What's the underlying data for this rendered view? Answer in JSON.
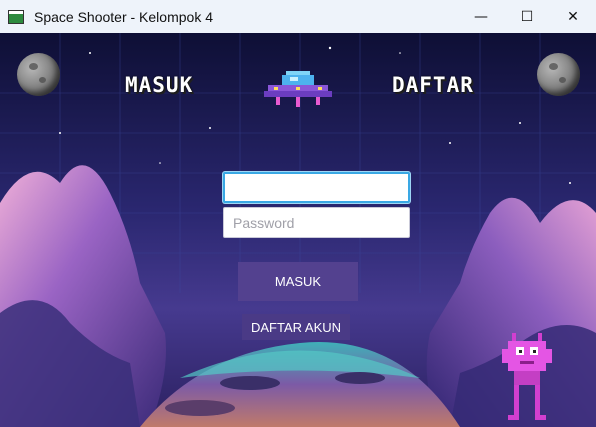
{
  "window": {
    "title": "Space Shooter - Kelompok 4",
    "minimize_glyph": "—",
    "maximize_glyph": "☐",
    "close_glyph": "✕"
  },
  "nav": {
    "login_label": "MASUK",
    "register_label": "DAFTAR"
  },
  "form": {
    "username_value": "",
    "username_placeholder": "",
    "password_placeholder": "Password"
  },
  "buttons": {
    "login_label": "MASUK",
    "register_account_label": "DAFTAR AKUN"
  },
  "icons": [
    "app-icon",
    "moon-icon",
    "ufo-icon",
    "alien-icon"
  ],
  "colors": {
    "titlebar": "#eef3fa",
    "button": "#53418f",
    "focus_border": "#3aa8e4"
  }
}
